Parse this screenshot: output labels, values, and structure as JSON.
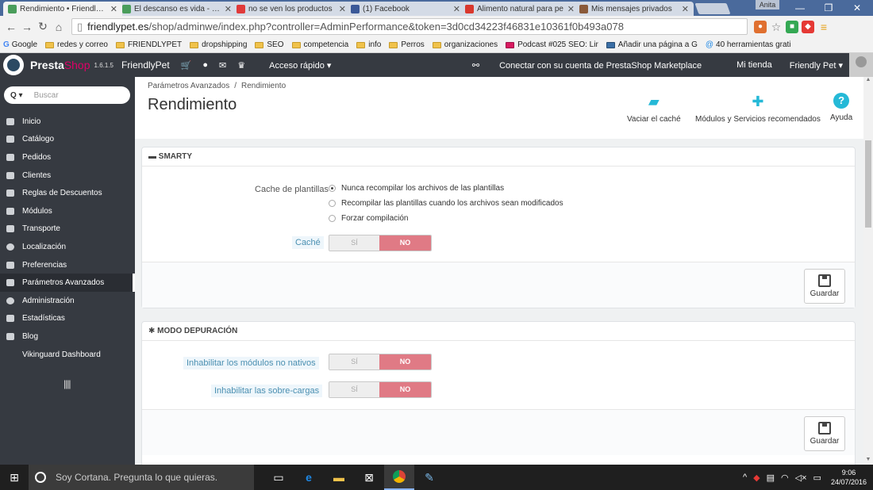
{
  "browser": {
    "tabs": [
      {
        "title": "Rendimiento • FriendlyPe",
        "favicon_color": "#4a9d5b",
        "active": true
      },
      {
        "title": "El descanso es vida - Frie",
        "favicon_color": "#4a9d5b"
      },
      {
        "title": "no se ven los productos",
        "favicon_color": "#e03a3a"
      },
      {
        "title": "(1) Facebook",
        "favicon_color": "#3b5998"
      },
      {
        "title": "Alimento natural para pe",
        "favicon_color": "#d9382d"
      },
      {
        "title": "Mis mensajes privados",
        "favicon_color": "#8a5a3a"
      }
    ],
    "user_label": "Anita",
    "url_host": "friendlypet.es",
    "url_path": "/shop/adminwe/index.php?controller=AdminPerformance&token=3d0cd34223f46831e10361f0b493a078",
    "bookmarks": [
      {
        "label": "Google",
        "type": "google"
      },
      {
        "label": "redes y correo",
        "type": "folder"
      },
      {
        "label": "FRIENDLYPET",
        "type": "folder"
      },
      {
        "label": "dropshipping",
        "type": "folder"
      },
      {
        "label": "SEO",
        "type": "folder"
      },
      {
        "label": "competencia",
        "type": "folder"
      },
      {
        "label": "info",
        "type": "folder"
      },
      {
        "label": "Perros",
        "type": "folder"
      },
      {
        "label": "organizaciones",
        "type": "folder"
      },
      {
        "label": "Podcast #025 SEO: Lir",
        "type": "page"
      },
      {
        "label": "Añadir una página a G",
        "type": "page"
      },
      {
        "label": "40 herramientas grati",
        "type": "page"
      }
    ]
  },
  "header": {
    "brand_a": "Presta",
    "brand_b": "Shop",
    "version": "1.6.1.5",
    "store": "FriendlyPet",
    "quick_access": "Acceso rápido ▾",
    "marketplace": "Conectar con su cuenta de PrestaShop Marketplace",
    "my_store": "Mi tienda",
    "user": "Friendly Pet ▾"
  },
  "sidebar": {
    "search_prefix": "Q ▾",
    "search_placeholder": "Buscar",
    "items": [
      {
        "label": "Inicio"
      },
      {
        "label": "Catálogo"
      },
      {
        "label": "Pedidos"
      },
      {
        "label": "Clientes"
      },
      {
        "label": "Reglas de Descuentos"
      },
      {
        "label": "Módulos"
      },
      {
        "label": "Transporte"
      },
      {
        "label": "Localización"
      },
      {
        "label": "Preferencias"
      },
      {
        "label": "Parámetros Avanzados",
        "active": true
      },
      {
        "label": "Administración"
      },
      {
        "label": "Estadísticas"
      },
      {
        "label": "Blog"
      },
      {
        "label": "Vikinguard Dashboard"
      }
    ],
    "collapse_label": "||||"
  },
  "page": {
    "breadcrumb_parent": "Parámetros Avanzados",
    "breadcrumb_current": "Rendimiento",
    "breadcrumb_sep": "/",
    "title": "Rendimiento",
    "toolbar": {
      "clear_cache": "Vaciar el caché",
      "modules": "Módulos y Servicios recomendados",
      "help": "Ayuda"
    }
  },
  "smarty": {
    "title": "SMARTY",
    "cache_templates_label": "Cache de plantillas",
    "options": [
      "Nunca recompilar los archivos de las plantillas",
      "Recompilar las plantillas cuando los archivos sean modificados",
      "Forzar compilación"
    ],
    "cache_label": "Caché",
    "yes": "SÍ",
    "no": "NO",
    "save": "Guardar"
  },
  "debug": {
    "title": "MODO DEPURACIÓN",
    "disable_nonnative": "Inhabilitar los módulos no nativos",
    "disable_overrides": "Inhabilitar las sobre-cargas",
    "yes": "SÍ",
    "no": "NO",
    "save": "Guardar"
  },
  "taskbar": {
    "cortana": "Soy Cortana. Pregunta lo que quieras.",
    "time": "9:06",
    "date": "24/07/2016"
  }
}
